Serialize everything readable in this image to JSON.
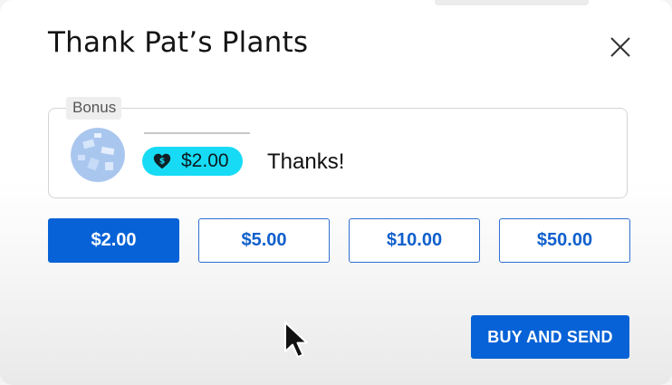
{
  "dialog": {
    "title": "Thank Pat’s Plants"
  },
  "icons": {
    "close": "close-icon",
    "cursor": "mouse-pointer-icon",
    "chip": "heart-dollar-icon"
  },
  "preview": {
    "bonus_label": "Bonus",
    "chip_amount": "$2.00",
    "message": "Thanks!"
  },
  "amounts": [
    {
      "label": "$2.00",
      "selected": true
    },
    {
      "label": "$5.00",
      "selected": false
    },
    {
      "label": "$10.00",
      "selected": false
    },
    {
      "label": "$50.00",
      "selected": false
    }
  ],
  "actions": {
    "buy_label": "BUY AND SEND"
  },
  "colors": {
    "accent": "#0662d6",
    "chip": "#17dbf5"
  }
}
